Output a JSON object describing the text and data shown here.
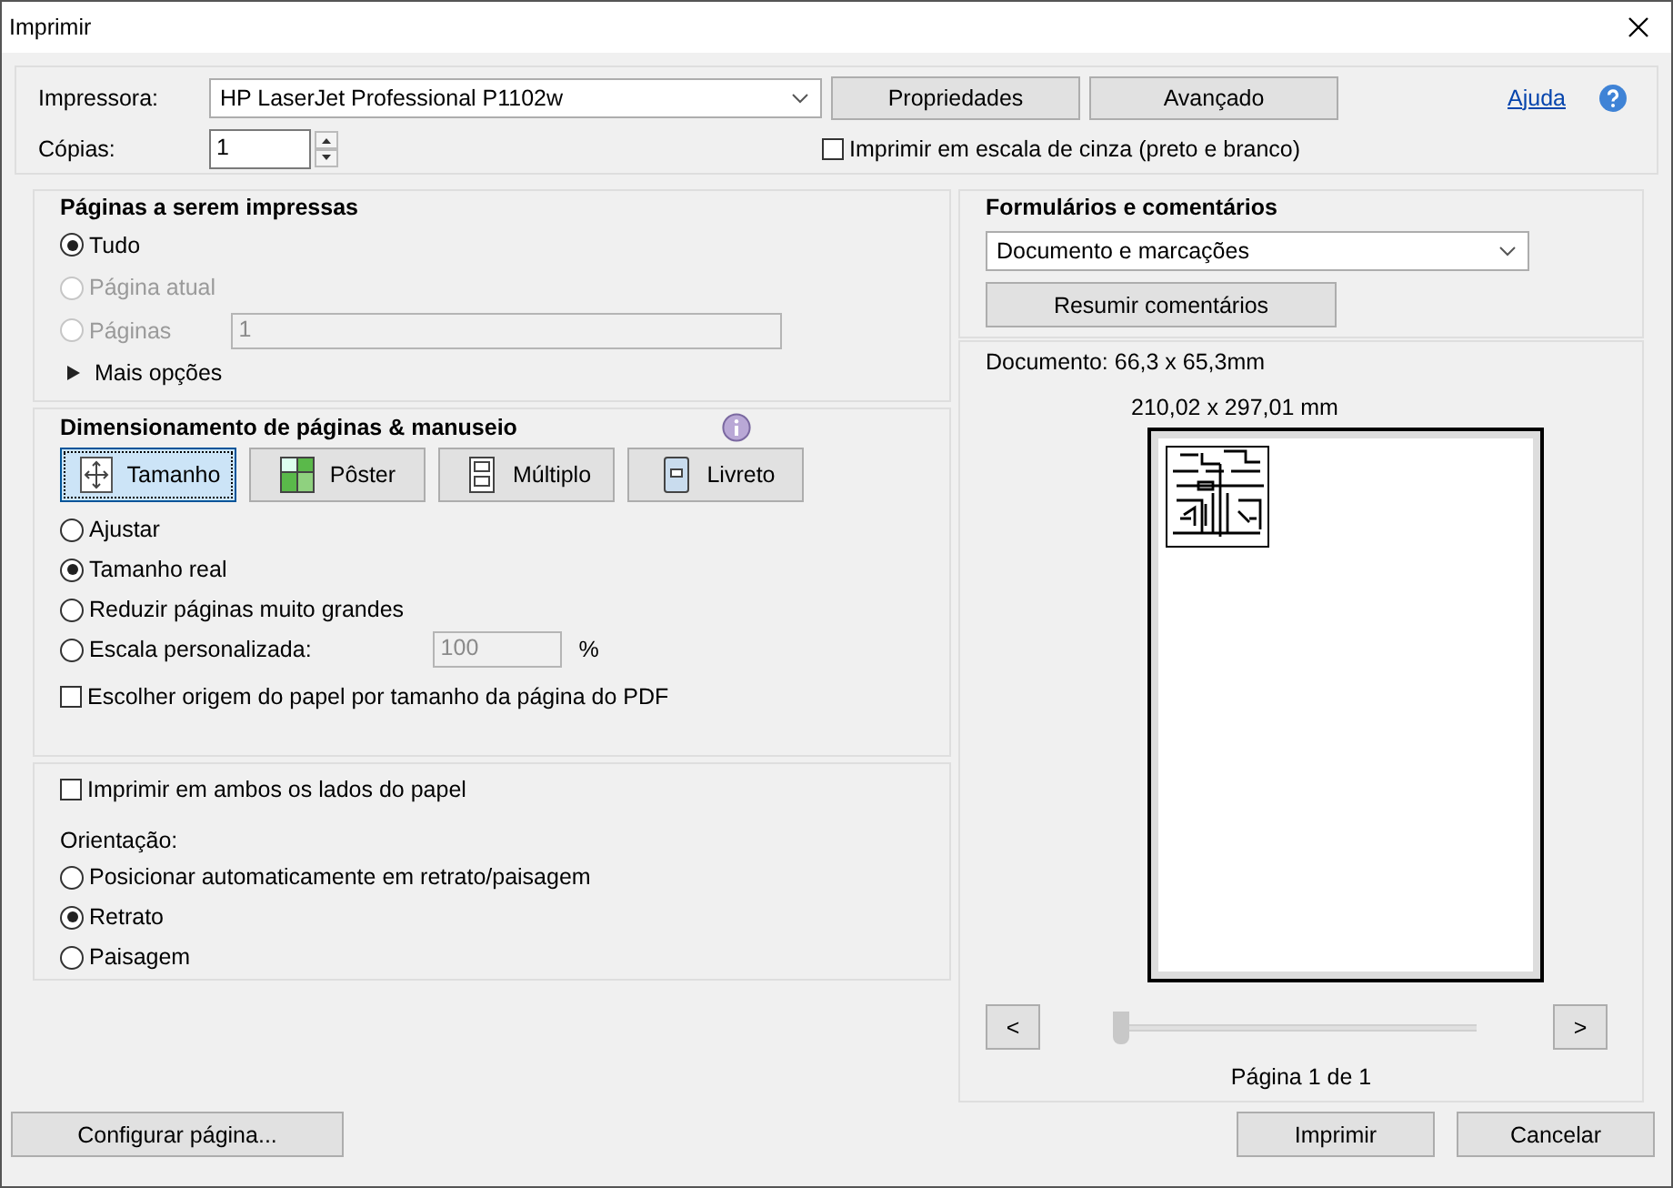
{
  "window": {
    "title": "Imprimir"
  },
  "printer": {
    "label": "Impressora:",
    "value": "HP LaserJet Professional P1102w",
    "buttons": [
      "Propriedades",
      "Avançado"
    ]
  },
  "help": {
    "link": "Ajuda"
  },
  "copies": {
    "label": "Cópias:",
    "value": "1"
  },
  "grayscale": {
    "label": "Imprimir em escala de cinza (preto e branco)",
    "checked": false
  },
  "pages_section": {
    "title": "Páginas a serem impressas",
    "options": [
      {
        "label": "Tudo",
        "selected": true,
        "disabled": false
      },
      {
        "label": "Página atual",
        "selected": false,
        "disabled": true
      },
      {
        "label": "Páginas",
        "selected": false,
        "disabled": true,
        "field": {
          "value": "1",
          "disabled": true
        }
      }
    ],
    "more": "Mais opções"
  },
  "sizing": {
    "title": "Dimensionamento de páginas & manuseio",
    "modes": [
      {
        "label": "Tamanho",
        "kind": "size",
        "selected": true
      },
      {
        "label": "Pôster",
        "kind": "poster",
        "selected": false
      },
      {
        "label": "Múltiplo",
        "kind": "multiple",
        "selected": false
      },
      {
        "label": "Livreto",
        "kind": "booklet",
        "selected": false
      }
    ],
    "options": [
      {
        "label": "Ajustar",
        "selected": false
      },
      {
        "label": "Tamanho real",
        "selected": true
      },
      {
        "label": "Reduzir páginas muito grandes",
        "selected": false
      },
      {
        "label": "Escala personalizada:",
        "selected": false,
        "field": {
          "value": "100",
          "disabled": true
        },
        "unit": "%"
      }
    ],
    "paper_source": {
      "label": "Escolher origem do papel por tamanho da página do PDF",
      "checked": false
    }
  },
  "duplex": {
    "label": "Imprimir em ambos os lados do papel",
    "checked": false
  },
  "orientation": {
    "title": "Orientação:",
    "options": [
      {
        "label": "Posicionar automaticamente em retrato/paisagem",
        "selected": false
      },
      {
        "label": "Retrato",
        "selected": true
      },
      {
        "label": "Paisagem",
        "selected": false
      }
    ]
  },
  "forms": {
    "title": "Formulários e comentários",
    "value": "Documento e marcações",
    "button": "Resumir comentários"
  },
  "preview": {
    "document_size": "Documento: 66,3 x 65,3mm",
    "paper_size": "210,02 x 297,01 mm",
    "prev": "<",
    "next": ">",
    "slider": {
      "level": 0
    },
    "page_label": "Página 1 de 1"
  },
  "footer": {
    "setup": "Configurar página...",
    "print": "Imprimir",
    "cancel": "Cancelar"
  }
}
